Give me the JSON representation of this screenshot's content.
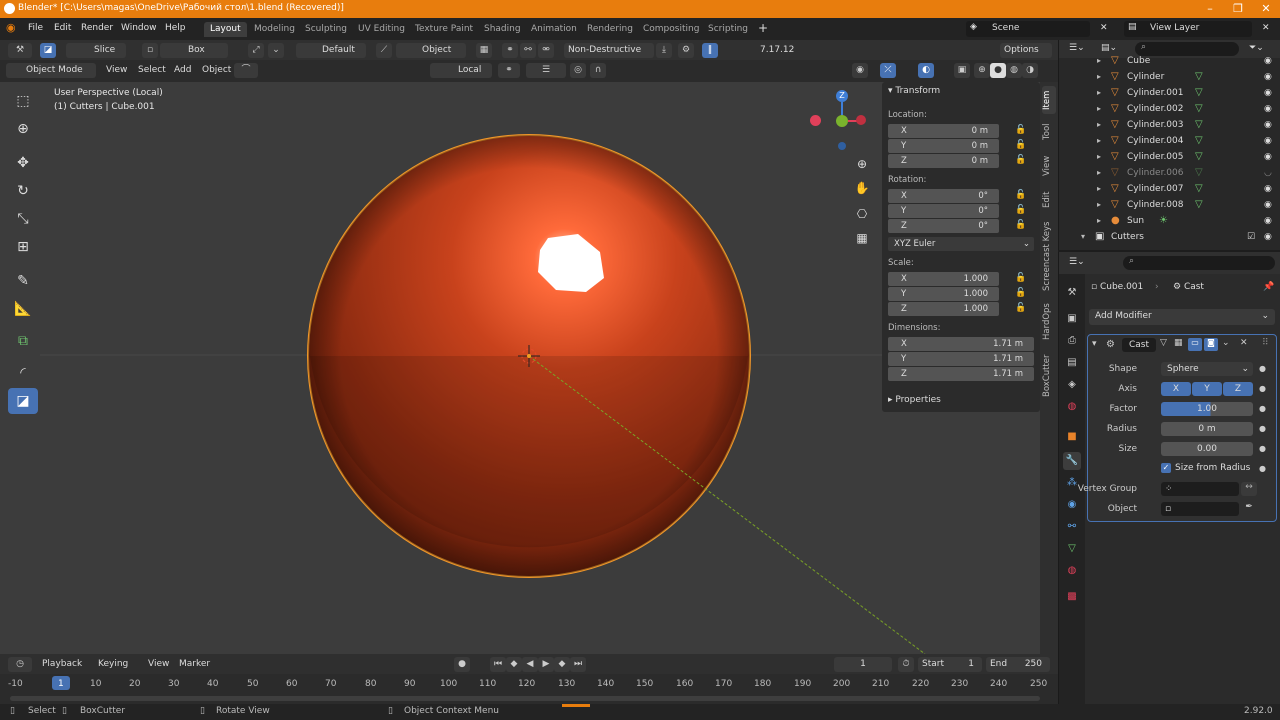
{
  "window": {
    "title": "Blender* [C:\\Users\\magas\\OneDrive\\Рабочий стол\\1.blend (Recovered)]",
    "controls": [
      "–",
      "❐",
      "✕"
    ]
  },
  "menus": [
    "File",
    "Edit",
    "Render",
    "Window",
    "Help"
  ],
  "workspaces": [
    {
      "label": "Layout",
      "active": true
    },
    {
      "label": "Modeling"
    },
    {
      "label": "Sculpting"
    },
    {
      "label": "UV Editing"
    },
    {
      "label": "Texture Paint"
    },
    {
      "label": "Shading"
    },
    {
      "label": "Animation"
    },
    {
      "label": "Rendering"
    },
    {
      "label": "Compositing"
    },
    {
      "label": "Scripting"
    }
  ],
  "add_workspace": "+",
  "scene": "Scene",
  "view_layer": "View Layer",
  "toolheader": {
    "tool": "Slice",
    "shape": "Box",
    "orientation": "Default",
    "mode2": "Object",
    "behavior": "Non-Destructive",
    "version": "7.17.12",
    "options": "Options"
  },
  "viewheader": {
    "mode": "Object Mode",
    "menus": [
      "View",
      "Select",
      "Add",
      "Object"
    ],
    "transform_orientation": "Local"
  },
  "viewport": {
    "info_line1": "User Perspective (Local)",
    "info_line2": "(1) Cutters | Cube.001",
    "gizmo": {
      "x": "",
      "y": "",
      "z": "Z"
    }
  },
  "npanel": {
    "transform_title": "Transform",
    "location_label": "Location:",
    "location": [
      {
        "axis": "X",
        "value": "0 m"
      },
      {
        "axis": "Y",
        "value": "0 m"
      },
      {
        "axis": "Z",
        "value": "0 m"
      }
    ],
    "rotation_label": "Rotation:",
    "rotation": [
      {
        "axis": "X",
        "value": "0°"
      },
      {
        "axis": "Y",
        "value": "0°"
      },
      {
        "axis": "Z",
        "value": "0°"
      }
    ],
    "rotation_mode": "XYZ Euler",
    "scale_label": "Scale:",
    "scale": [
      {
        "axis": "X",
        "value": "1.000"
      },
      {
        "axis": "Y",
        "value": "1.000"
      },
      {
        "axis": "Z",
        "value": "1.000"
      }
    ],
    "dimensions_label": "Dimensions:",
    "dimensions": [
      {
        "axis": "X",
        "value": "1.71 m"
      },
      {
        "axis": "Y",
        "value": "1.71 m"
      },
      {
        "axis": "Z",
        "value": "1.71 m"
      }
    ],
    "properties_title": "Properties"
  },
  "sidetabs": [
    "Item",
    "Tool",
    "View",
    "Edit",
    "Screencast Keys",
    "HardOps",
    "BoxCutter"
  ],
  "timeline": {
    "menus": [
      "Playback",
      "Keying",
      "View",
      "Marker"
    ],
    "current_frame": "1",
    "start_label": "Start",
    "start": "1",
    "end_label": "End",
    "end": "250",
    "ticks": [
      "-10",
      "1",
      "10",
      "20",
      "30",
      "40",
      "50",
      "60",
      "70",
      "80",
      "90",
      "100",
      "110",
      "120",
      "130",
      "140",
      "150",
      "160",
      "170",
      "180",
      "190",
      "200",
      "210",
      "220",
      "230",
      "240",
      "250"
    ]
  },
  "statusbar": {
    "select": "Select",
    "boxcutter": "BoxCutter",
    "rotate": "Rotate View",
    "context": "Object Context Menu",
    "version": "2.92.0"
  },
  "outliner": {
    "rows": [
      {
        "name": "Cube",
        "dim": false
      },
      {
        "name": "Cylinder",
        "dim": false
      },
      {
        "name": "Cylinder.001",
        "dim": false
      },
      {
        "name": "Cylinder.002",
        "dim": false
      },
      {
        "name": "Cylinder.003",
        "dim": false
      },
      {
        "name": "Cylinder.004",
        "dim": false
      },
      {
        "name": "Cylinder.005",
        "dim": false
      },
      {
        "name": "Cylinder.006",
        "dim": true
      },
      {
        "name": "Cylinder.007",
        "dim": false
      },
      {
        "name": "Cylinder.008",
        "dim": false
      },
      {
        "name": "Sun",
        "dim": false
      }
    ],
    "collection": "Cutters"
  },
  "properties": {
    "object": "Cube.001",
    "modifier_breadcrumb": "Cast",
    "add_modifier": "Add Modifier",
    "modifier_name": "Cast",
    "shape_label": "Shape",
    "shape": "Sphere",
    "axis_label": "Axis",
    "axes": [
      "X",
      "Y",
      "Z"
    ],
    "factor_label": "Factor",
    "factor": "1.00",
    "radius_label": "Radius",
    "radius": "0 m",
    "size_label": "Size",
    "size": "0.00",
    "size_from_radius": "Size from Radius",
    "vertex_group_label": "Vertex Group",
    "object_label": "Object"
  },
  "colors": {
    "accent": "#e87d0d",
    "selection": "#4772b3",
    "sphere": "#b33a18"
  }
}
